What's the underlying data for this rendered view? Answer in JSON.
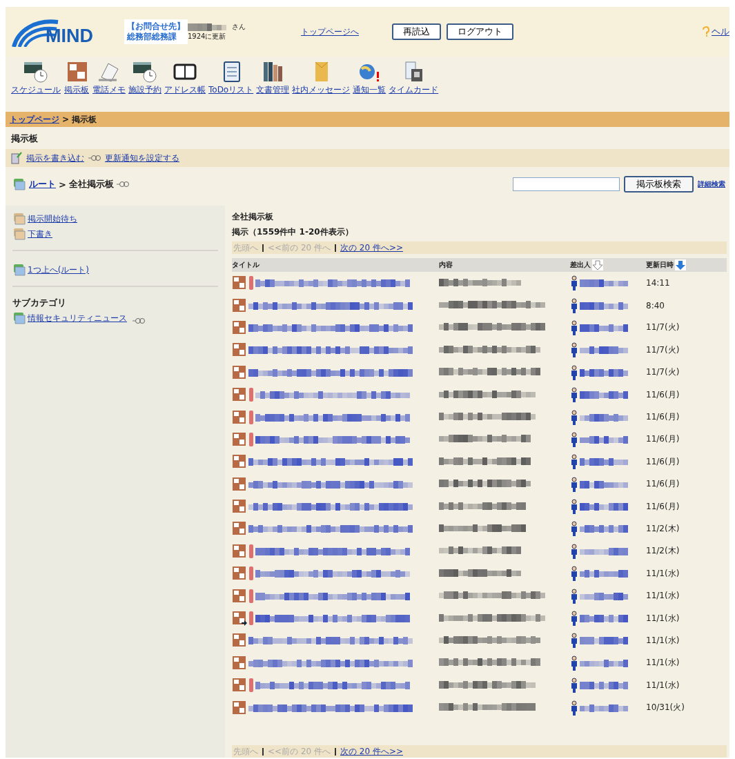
{
  "header": {
    "logo": "MIND",
    "contact": [
      "【お問合せ先】",
      "総務部総務課"
    ],
    "user_suffix": "さん",
    "updated": "1924に更新",
    "top_link": "トップページへ",
    "buttons": [
      "再読込",
      "ログアウト"
    ],
    "help": "ヘル"
  },
  "toolbar": [
    {
      "label": "スケジュール",
      "kind": "schedule"
    },
    {
      "label": "掲示板",
      "kind": "board"
    },
    {
      "label": "電話メモ",
      "kind": "phone"
    },
    {
      "label": "施設予約",
      "kind": "schedule"
    },
    {
      "label": "アドレス帳",
      "kind": "address"
    },
    {
      "label": "ToDoリスト",
      "kind": "todo"
    },
    {
      "label": "文書管理",
      "kind": "docs"
    },
    {
      "label": "社内メッセージ",
      "kind": "message"
    },
    {
      "label": "通知一覧",
      "kind": "notice"
    },
    {
      "label": "タイムカード",
      "kind": "timecard"
    }
  ],
  "breadcrumb_separator": ">",
  "breadcrumb": [
    {
      "label": "トップページ",
      "link": true
    },
    {
      "label": "掲示板",
      "link": false
    }
  ],
  "page_title": "掲示板",
  "actions": [
    {
      "label": "掲示を書き込む",
      "kind": "write"
    },
    {
      "label": "更新通知を設定する",
      "kind": "watch"
    }
  ],
  "path": {
    "root": "ルート",
    "separator": ">",
    "current": "全社掲示板"
  },
  "search": {
    "button": "掲示板検索",
    "advanced": "詳細検索"
  },
  "sidebar": {
    "folders": [
      {
        "label": "掲示開始待ち"
      },
      {
        "label": "下書き"
      }
    ],
    "up": "1つ上へ(ルート)",
    "subcategory_title": "サブカテゴリ",
    "subcategories": [
      {
        "label": "情報セキュリティニュース"
      }
    ]
  },
  "board": {
    "title": "全社掲示板",
    "count": "掲示（1559件中 1-20件表示）",
    "pager_top": [
      {
        "label": "先頭へ",
        "disabled": true
      },
      {
        "label": "<<前の 20 件へ",
        "disabled": true
      },
      {
        "label": "次の 20 件へ>>",
        "disabled": false
      }
    ],
    "columns": [
      {
        "label": "タイトル",
        "kind": "plain"
      },
      {
        "label": "内容",
        "kind": "plain"
      },
      {
        "label": "差出人",
        "kind": "sortable"
      },
      {
        "label": "更新日時",
        "kind": "sorted"
      }
    ],
    "rows": [
      {
        "date": "14:11",
        "flagged": true,
        "forwarded": false
      },
      {
        "date": "8:40",
        "flagged": false,
        "forwarded": false
      },
      {
        "date": "11/7(火)",
        "flagged": false,
        "forwarded": false
      },
      {
        "date": "11/7(火)",
        "flagged": false,
        "forwarded": false
      },
      {
        "date": "11/7(火)",
        "flagged": false,
        "forwarded": false
      },
      {
        "date": "11/6(月)",
        "flagged": true,
        "forwarded": false
      },
      {
        "date": "11/6(月)",
        "flagged": true,
        "forwarded": false
      },
      {
        "date": "11/6(月)",
        "flagged": true,
        "forwarded": false
      },
      {
        "date": "11/6(月)",
        "flagged": false,
        "forwarded": false
      },
      {
        "date": "11/6(月)",
        "flagged": false,
        "forwarded": false
      },
      {
        "date": "11/6(月)",
        "flagged": false,
        "forwarded": false
      },
      {
        "date": "11/2(木)",
        "flagged": false,
        "forwarded": false
      },
      {
        "date": "11/2(木)",
        "flagged": true,
        "forwarded": false
      },
      {
        "date": "11/1(水)",
        "flagged": true,
        "forwarded": false
      },
      {
        "date": "11/1(水)",
        "flagged": true,
        "forwarded": false
      },
      {
        "date": "11/1(水)",
        "flagged": true,
        "forwarded": true
      },
      {
        "date": "11/1(水)",
        "flagged": false,
        "forwarded": false
      },
      {
        "date": "11/1(水)",
        "flagged": false,
        "forwarded": false
      },
      {
        "date": "11/1(水)",
        "flagged": true,
        "forwarded": false
      },
      {
        "date": "10/31(火)",
        "flagged": false,
        "forwarded": false
      }
    ],
    "pager_bottom": [
      {
        "label": "先頭へ",
        "disabled": true
      },
      {
        "label": "<<前の 20 件へ",
        "disabled": true
      },
      {
        "label": "次の 20 件へ>>",
        "disabled": false
      }
    ]
  }
}
